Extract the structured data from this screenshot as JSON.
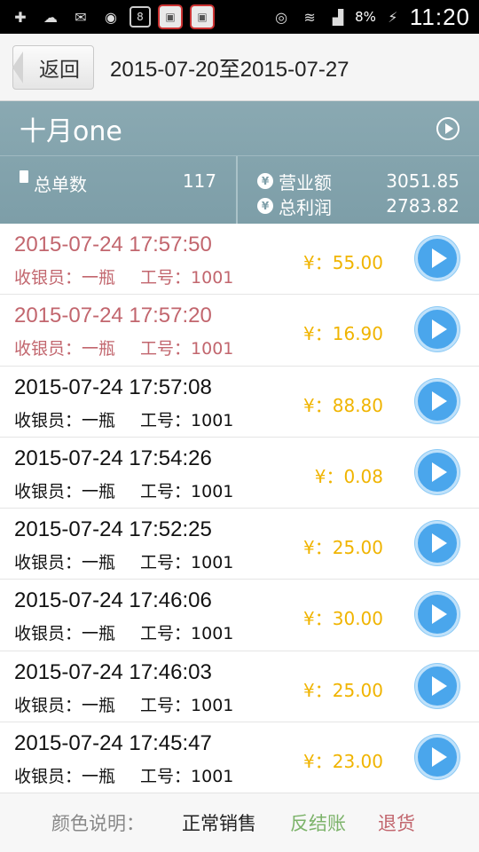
{
  "status_bar": {
    "battery": "8%",
    "time": "11:20",
    "notification_badge": "8"
  },
  "header": {
    "back_label": "返回",
    "date_range": "2015-07-20至2015-07-27"
  },
  "summary": {
    "store_name": "十月one",
    "order_count_label": "总单数",
    "order_count": "117",
    "revenue_label": "营业额",
    "revenue": "3051.85",
    "profit_label": "总利润",
    "profit": "2783.82"
  },
  "orders": [
    {
      "datetime": "2015-07-24 17:57:50",
      "cashier": "收银员：一瓶",
      "emp_no": "工号：1001",
      "amount": "¥：55.00",
      "status": "refund"
    },
    {
      "datetime": "2015-07-24 17:57:20",
      "cashier": "收银员：一瓶",
      "emp_no": "工号：1001",
      "amount": "¥：16.90",
      "status": "refund"
    },
    {
      "datetime": "2015-07-24 17:57:08",
      "cashier": "收银员：一瓶",
      "emp_no": "工号：1001",
      "amount": "¥：88.80",
      "status": "normal"
    },
    {
      "datetime": "2015-07-24 17:54:26",
      "cashier": "收银员：一瓶",
      "emp_no": "工号：1001",
      "amount": "¥：0.08",
      "status": "normal"
    },
    {
      "datetime": "2015-07-24 17:52:25",
      "cashier": "收银员：一瓶",
      "emp_no": "工号：1001",
      "amount": "¥：25.00",
      "status": "normal"
    },
    {
      "datetime": "2015-07-24 17:46:06",
      "cashier": "收银员：一瓶",
      "emp_no": "工号：1001",
      "amount": "¥：30.00",
      "status": "normal"
    },
    {
      "datetime": "2015-07-24 17:46:03",
      "cashier": "收银员：一瓶",
      "emp_no": "工号：1001",
      "amount": "¥：25.00",
      "status": "normal"
    },
    {
      "datetime": "2015-07-24 17:45:47",
      "cashier": "收银员：一瓶",
      "emp_no": "工号：1001",
      "amount": "¥：23.00",
      "status": "normal"
    }
  ],
  "legend": {
    "title": "颜色说明：",
    "normal": "正常销售",
    "reverse": "反结账",
    "refund": "退货"
  },
  "colors": {
    "summary_bg": "#7d9ea8",
    "amount": "#f0b400",
    "refund": "#c2666e",
    "reverse": "#7cb36a",
    "play_button": "#4aa6ec"
  }
}
